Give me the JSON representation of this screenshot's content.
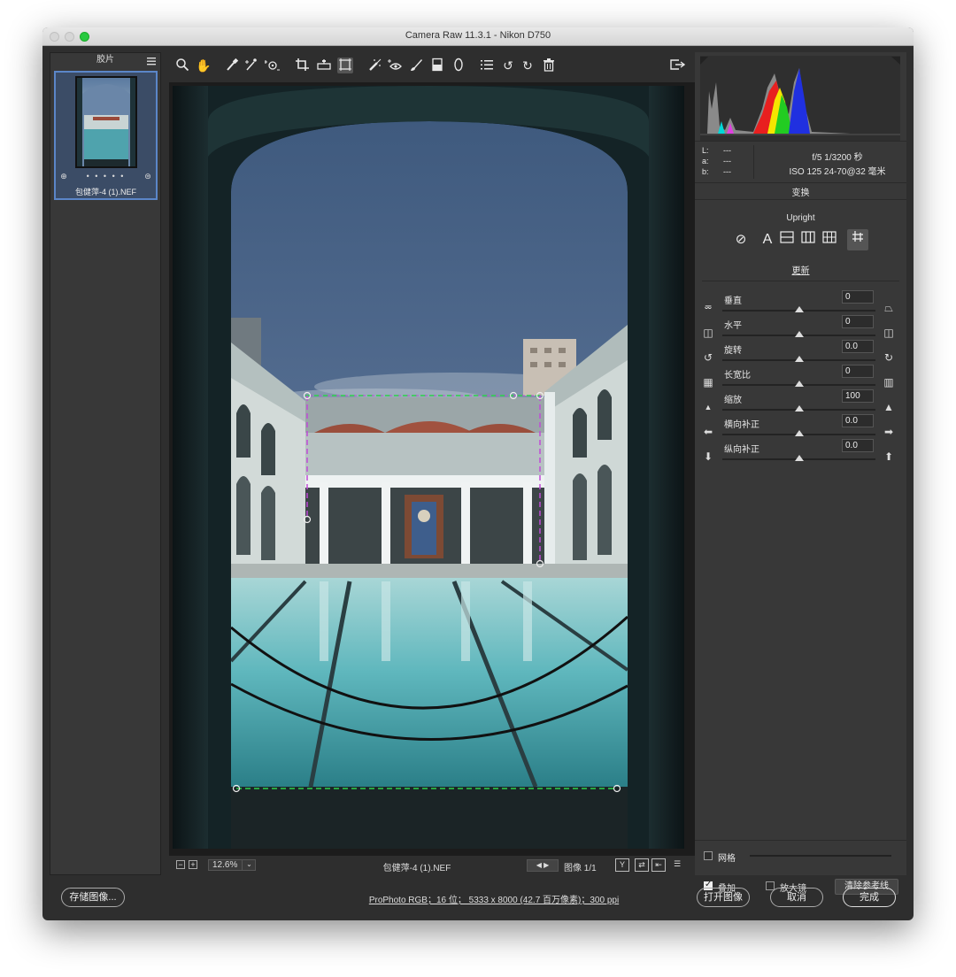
{
  "window": {
    "title": "Camera Raw 11.3.1 -  Nikon D750"
  },
  "filmstrip": {
    "header": "胶片",
    "thumbnail": {
      "dots": "• • • • •",
      "filename": "包健萍-4 (1).NEF"
    }
  },
  "toolbar": {
    "tools": [
      "zoom-tool",
      "hand-tool",
      "white-balance-tool",
      "color-sampler-tool",
      "targeted-adjustment-tool",
      "crop-tool",
      "straighten-tool",
      "transform-tool",
      "spot-removal-tool",
      "red-eye-tool",
      "adjustment-brush",
      "graduated-filter",
      "radial-filter",
      "presets-list",
      "rotate-ccw",
      "rotate-cw",
      "delete"
    ],
    "active_tool": "transform-tool"
  },
  "canvas_bar": {
    "zoom_minus": "−",
    "zoom_plus": "+",
    "zoom": "12.6%",
    "filename": "包健萍-4 (1).NEF",
    "image_count": "图像 1/1",
    "view_y": "Y"
  },
  "info": {
    "L_label": "L:",
    "L": "---",
    "a_label": "a:",
    "a": "---",
    "b_label": "b:",
    "b": "---",
    "aperture_shutter": "f/5  1/3200 秒",
    "iso_lens": "ISO 125  24-70@32 毫米"
  },
  "panel": {
    "section_title": "变换",
    "upright_label": "Upright",
    "upright_buttons": [
      "off",
      "auto",
      "level",
      "vertical",
      "full",
      "guided"
    ],
    "update_label": "更新",
    "sliders": [
      {
        "label": "垂直",
        "value": "0"
      },
      {
        "label": "水平",
        "value": "0"
      },
      {
        "label": "旋转",
        "value": "0.0"
      },
      {
        "label": "长宽比",
        "value": "0"
      },
      {
        "label": "缩放",
        "value": "100"
      },
      {
        "label": "横向补正",
        "value": "0.0"
      },
      {
        "label": "纵向补正",
        "value": "0.0"
      }
    ],
    "grid_label": "网格",
    "overlay_label": "叠加",
    "loupe_label": "放大镜",
    "clear_guides_label": "清除参考线"
  },
  "bottom": {
    "save_label": "存储图像...",
    "workflow_info": "ProPhoto RGB；16 位；  5333 x 8000 (42.7 百万像素)；300 ppi",
    "open_label": "打开图像",
    "cancel_label": "取消",
    "done_label": "完成"
  },
  "colors": {
    "accent": "#5b86c8",
    "guide_green": "#2cd24a",
    "guide_magenta": "#c04bd8"
  }
}
